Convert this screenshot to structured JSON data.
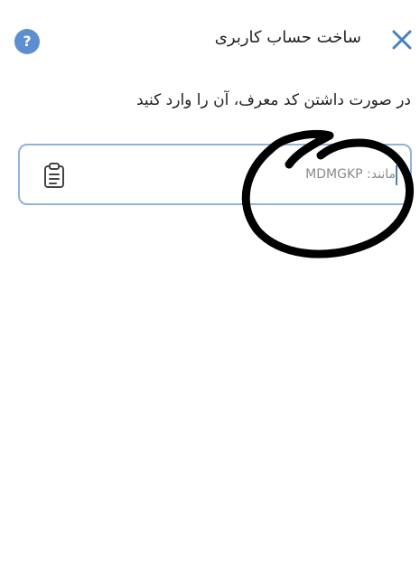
{
  "header": {
    "title": "ساخت حساب کاربری",
    "close_icon": "close-icon",
    "help_icon": "question-mark-icon",
    "help_label": "?"
  },
  "referral": {
    "instruction": "در صورت داشتن کد معرف، آن را وارد کنید",
    "input_value": "",
    "input_placeholder": "مانند: MDMGKP",
    "paste_icon": "clipboard-icon"
  },
  "colors": {
    "accent": "#4a7fc0",
    "input_border": "#8fb4db",
    "help_bg": "#5b8fd1",
    "text": "#222222",
    "placeholder": "#8a8a8a",
    "scribble": "#000000"
  }
}
